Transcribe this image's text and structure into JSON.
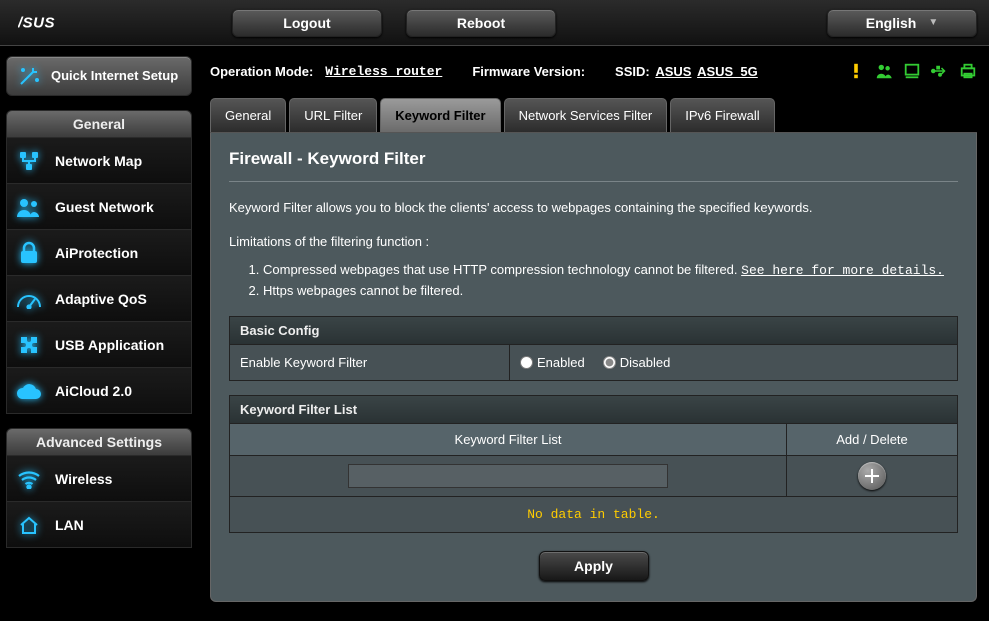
{
  "top": {
    "logout": "Logout",
    "reboot": "Reboot",
    "language": "English"
  },
  "info": {
    "op_mode_label": "Operation Mode:",
    "op_mode_value": "Wireless router",
    "fw_label": "Firmware Version:",
    "ssid_label": "SSID:",
    "ssid_1": "ASUS",
    "ssid_2": "ASUS_5G"
  },
  "sidebar": {
    "qis_label": "Quick Internet Setup",
    "general_header": "General",
    "general_items": [
      {
        "label": "Network Map"
      },
      {
        "label": "Guest Network"
      },
      {
        "label": "AiProtection"
      },
      {
        "label": "Adaptive QoS"
      },
      {
        "label": "USB Application"
      },
      {
        "label": "AiCloud 2.0"
      }
    ],
    "advanced_header": "Advanced Settings",
    "advanced_items": [
      {
        "label": "Wireless"
      },
      {
        "label": "LAN"
      }
    ]
  },
  "tabs": [
    {
      "label": "General"
    },
    {
      "label": "URL Filter"
    },
    {
      "label": "Keyword Filter",
      "active": true
    },
    {
      "label": "Network Services Filter"
    },
    {
      "label": "IPv6 Firewall"
    }
  ],
  "page": {
    "title": "Firewall - Keyword Filter",
    "desc": "Keyword Filter allows you to block the clients' access to webpages containing the specified keywords.",
    "limit_title": "Limitations of the filtering function :",
    "limit1_a": "Compressed webpages that use HTTP compression technology cannot be filtered. ",
    "limit1_link": "See here for more details.",
    "limit2": "Https webpages cannot be filtered.",
    "basic_header": "Basic Config",
    "enable_label": "Enable Keyword Filter",
    "enabled_text": "Enabled",
    "disabled_text": "Disabled",
    "filter_list_header": "Keyword Filter List",
    "col_keyword": "Keyword Filter List",
    "col_action": "Add / Delete",
    "nodata": "No data in table.",
    "apply": "Apply"
  }
}
